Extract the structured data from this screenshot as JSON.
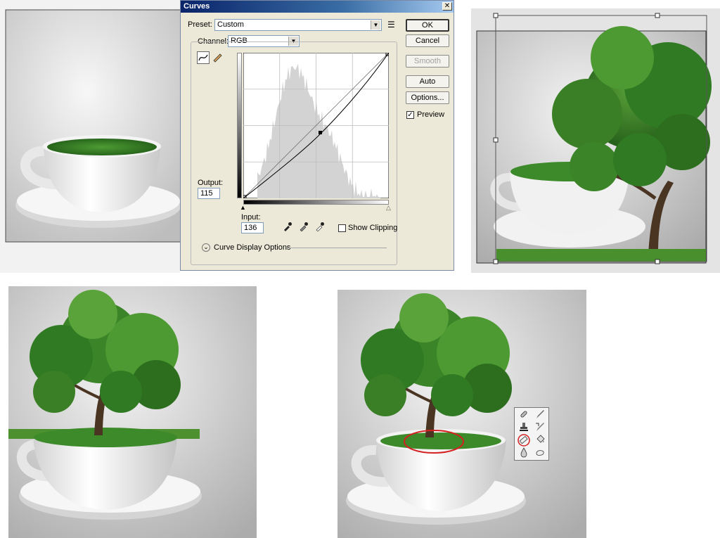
{
  "dialog": {
    "title": "Curves",
    "close_glyph": "✕",
    "preset_label": "Preset:",
    "preset_value": "Custom",
    "preset_menu_glyph": "☰",
    "channel_label": "Channel:",
    "channel_value": "RGB",
    "output_label": "Output:",
    "output_value": "115",
    "input_label": "Input:",
    "input_value": "136",
    "buttons": {
      "ok": "OK",
      "cancel": "Cancel",
      "smooth": "Smooth",
      "auto": "Auto",
      "options": "Options..."
    },
    "preview_label": "Preview",
    "preview_checked": true,
    "show_clipping_label": "Show Clipping",
    "show_clipping_checked": false,
    "curve_display_options": "Curve Display Options",
    "expand_glyph": "⌄",
    "curve_tool_icon": "curve-point-icon",
    "pencil_tool_icon": "pencil-icon",
    "eyedropper_icons": [
      "black-eyedropper-icon",
      "gray-eyedropper-icon",
      "white-eyedropper-icon"
    ]
  },
  "panels": {
    "top_left": "cup-with-grass",
    "top_right": "tree-transform-over-cup",
    "bottom_left": "tree-planted-in-cup",
    "bottom_right": "final-composition-with-eraser"
  },
  "tools_palette": {
    "tools": [
      "healing-brush-icon",
      "brush-icon",
      "clone-stamp-icon",
      "history-brush-icon",
      "eraser-icon",
      "paint-bucket-icon",
      "blur-icon",
      "smudge-icon"
    ],
    "highlighted_tool": "eraser-icon",
    "highlight_color": "#d42020"
  },
  "colors": {
    "grass": "#3d8a2b",
    "foliage": "#2f7a22",
    "trunk": "#4a3422",
    "title_bar": "#0a246a"
  }
}
